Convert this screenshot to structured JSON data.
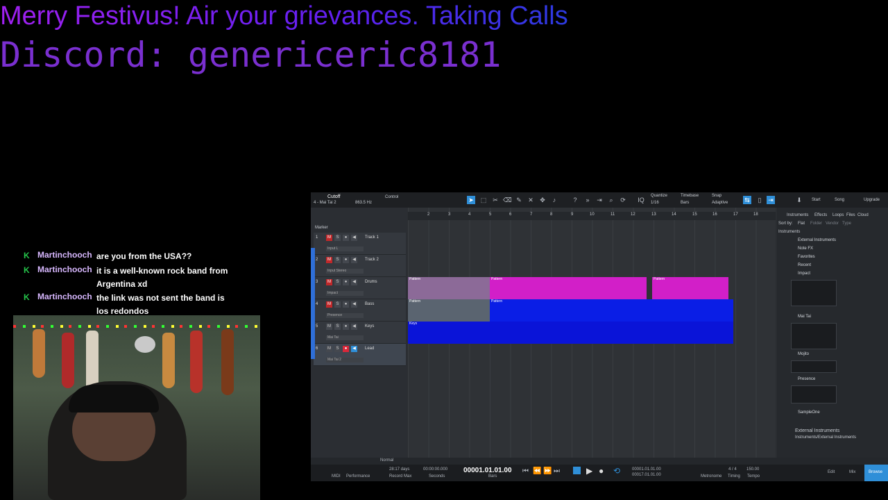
{
  "overlay": {
    "headline": "Merry Festivus! Air your grievances. Taking Calls",
    "discord": "Discord: genericeric8181"
  },
  "chat": [
    {
      "user": "Martinchooch",
      "message": "are you from the USA??"
    },
    {
      "user": "Martinchooch",
      "message": "it is a well-known rock band from Argentina xd"
    },
    {
      "user": "Martinchooch",
      "message": "the link was not sent the band is los redondos"
    }
  ],
  "daw": {
    "instrument_name": "Cutoff",
    "instrument_sub": "4 - Mai Tai 2",
    "freq": "863.5 Hz",
    "control_label": "Control",
    "quantize_label": "Quantize",
    "quantize_value": "1/16",
    "timebase_label": "Timebase",
    "timebase_value": "Bars",
    "snap_label": "Snap",
    "snap_value": "Adaptive",
    "start": "Start",
    "song": "Song",
    "upgrade": "Upgrade",
    "marker": "Marker",
    "ruler": [
      "2",
      "3",
      "4",
      "5",
      "6",
      "7",
      "8",
      "9",
      "10",
      "11",
      "12",
      "13",
      "14",
      "15",
      "16",
      "17",
      "18"
    ],
    "tracks": [
      {
        "num": "1",
        "name": "Track 1",
        "sub": "Input L"
      },
      {
        "num": "2",
        "name": "Track 2",
        "sub": "Input Stereo"
      },
      {
        "num": "3",
        "name": "Drums",
        "sub": "Impact"
      },
      {
        "num": "4",
        "name": "Bass",
        "sub": "Presence"
      },
      {
        "num": "5",
        "name": "Keys",
        "sub": "Mai Tai"
      },
      {
        "num": "6",
        "name": "Lead",
        "sub": "Mai Tai 2"
      }
    ],
    "clip_pattern": "Pattern",
    "clip_keys": "Keys",
    "browser": {
      "tabs": [
        "Instruments",
        "Effects",
        "Loops",
        "Files",
        "Cloud"
      ],
      "sort_label": "Sort by:",
      "sort_options": [
        "Flat",
        "Folder",
        "Vendor",
        "Type"
      ],
      "root": "Instruments",
      "items": [
        "External Instruments",
        "Note FX",
        "Favorites",
        "Recent",
        "Impact",
        "Mai Tai",
        "Mojito",
        "Presence",
        "SampleOne"
      ],
      "footer_title": "External Instruments",
      "footer_path": "Instruments/External Instruments"
    },
    "transport": {
      "midi": "MIDI",
      "performance": "Performance",
      "record_time": "28:17 days",
      "record_max": "Record Max",
      "seconds_value": "00:00:00.000",
      "seconds": "Seconds",
      "position": "00001.01.01.00",
      "bars": "Bars",
      "loop_start": "00001.01.01.00",
      "loop_end": "00017.01.01.00",
      "metronome": "Metronome",
      "signature": "4 / 4",
      "timing": "Timing",
      "tempo_value": "150.00",
      "tempo": "Tempo",
      "edit": "Edit",
      "mix": "Mix",
      "browse": "Browse",
      "normal": "Normal"
    }
  },
  "colors": {
    "drums_clip": "#d21fc8",
    "bass_clip": "#0a1ee6",
    "keys_clip": "#0a14d8",
    "accent": "#2f8fd8"
  }
}
